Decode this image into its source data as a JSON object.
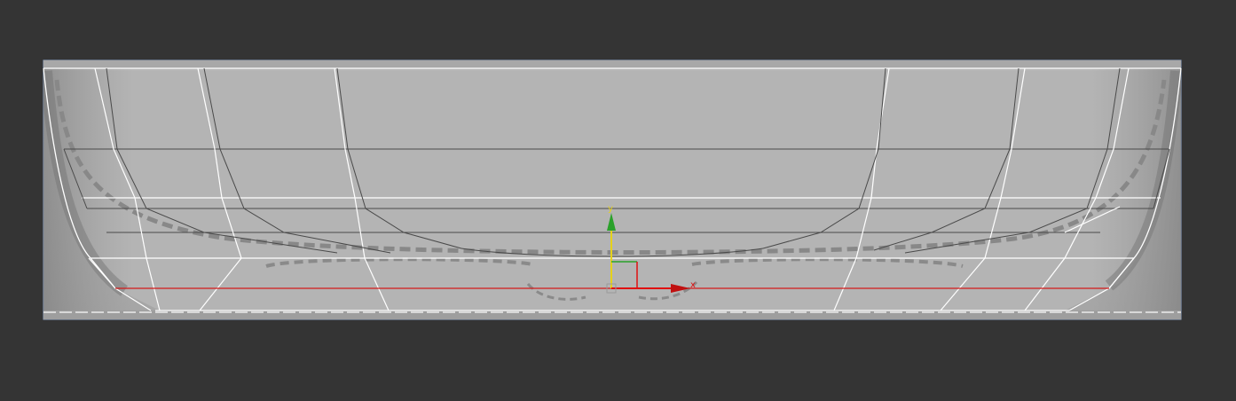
{
  "viewport": {
    "background_color": "#343434",
    "plane_color": "#c4c4c4",
    "frame_color": "#8fa6c8"
  },
  "gizmo": {
    "x_axis_label": "x",
    "y_axis_label": "y",
    "x_color": "#e01010",
    "y_color": "#e6d21a",
    "y_arrow_color": "#2aa12a"
  },
  "mesh": {
    "edge_color": "#ffffff",
    "inner_edge_color": "#4a4a4a",
    "selected_edge_color": "#d41a1a"
  }
}
